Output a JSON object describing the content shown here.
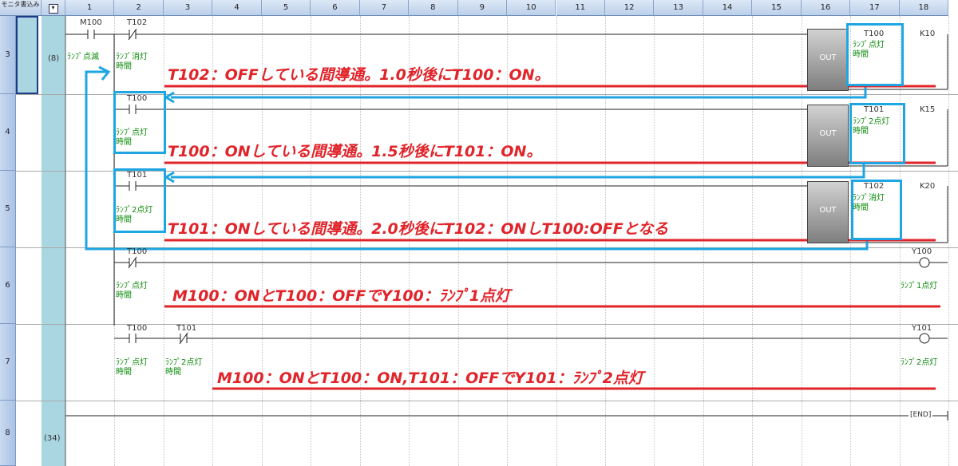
{
  "header": {
    "corner": "モニタ書込み",
    "dropdown_icon": "chevron-down-icon",
    "columns": [
      "1",
      "2",
      "3",
      "4",
      "5",
      "6",
      "7",
      "8",
      "9",
      "10",
      "11",
      "12",
      "13",
      "14",
      "15",
      "16",
      "17",
      "18"
    ]
  },
  "rows": [
    "3",
    "4",
    "5",
    "6",
    "7",
    "8"
  ],
  "step_numbers": {
    "row3": "(8)",
    "row8": "(34)"
  },
  "rung3": {
    "m100": "M100",
    "m100_comment": "ﾗﾝﾌﾟ点滅",
    "t102": "T102",
    "t102_comment": [
      "ﾗﾝﾌﾟ消灯",
      "時間"
    ],
    "out_label": "OUT",
    "coil": "T100",
    "coil_comment": [
      "ﾗﾝﾌﾟ点灯",
      "時間"
    ],
    "k": "K10",
    "note": "T102：OFFしている間導通。1.0秒後にT100：ON。"
  },
  "rung4": {
    "contact": "T100",
    "contact_comment": [
      "ﾗﾝﾌﾟ点灯",
      "時間"
    ],
    "out_label": "OUT",
    "coil": "T101",
    "coil_comment": [
      "ﾗﾝﾌﾟ2点灯",
      "時間"
    ],
    "k": "K15",
    "note": "T100：ONしている間導通。1.5秒後にT101：ON。"
  },
  "rung5": {
    "contact": "T101",
    "contact_comment": [
      "ﾗﾝﾌﾟ2点灯",
      "時間"
    ],
    "out_label": "OUT",
    "coil": "T102",
    "coil_comment": [
      "ﾗﾝﾌﾟ消灯",
      "時間"
    ],
    "k": "K20",
    "note": "T101：ONしている間導通。2.0秒後にT102：ONしT100:OFFとなる"
  },
  "rung6": {
    "contact": "T100",
    "contact_comment": [
      "ﾗﾝﾌﾟ点灯",
      "時間"
    ],
    "coil": "Y100",
    "coil_comment": "ﾗﾝﾌﾟ1点灯",
    "note": "M100：ONとT100：OFFでY100：ﾗﾝﾌﾟ1点灯"
  },
  "rung7": {
    "contact1": "T100",
    "contact1_comment": [
      "ﾗﾝﾌﾟ点灯",
      "時間"
    ],
    "contact2": "T101",
    "contact2_comment": [
      "ﾗﾝﾌﾟ2点灯",
      "時間"
    ],
    "coil": "Y101",
    "coil_comment": "ﾗﾝﾌﾟ2点灯",
    "note": "M100：ONとT100：ON,T101：OFFでY101：ﾗﾝﾌﾟ2点灯"
  },
  "rung8": {
    "end": "END"
  },
  "colors": {
    "annotation_red": "#e0242a",
    "highlight_blue": "#1ea6e2",
    "comment_green": "#0a8a0a"
  }
}
